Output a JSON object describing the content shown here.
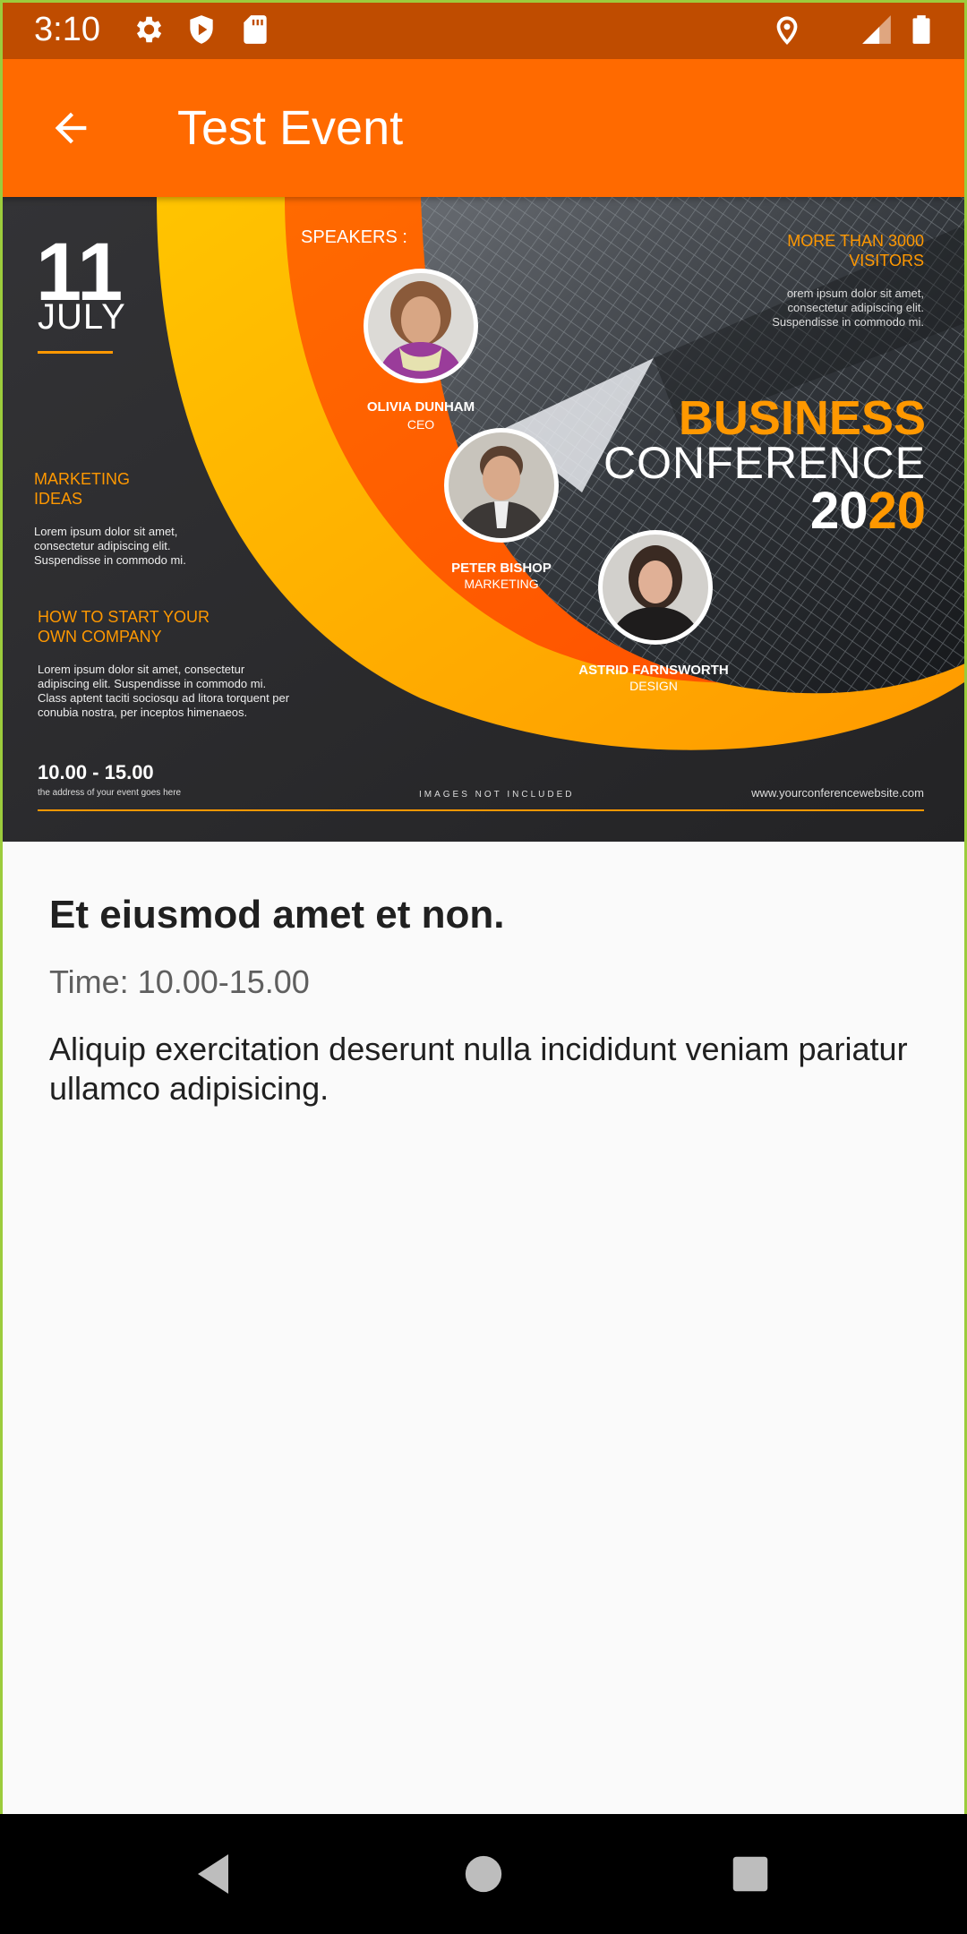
{
  "status_bar": {
    "time": "3:10",
    "icons": [
      "gear-icon",
      "shield-play-icon",
      "sd-card-icon",
      "location-pin-icon",
      "signal-icon",
      "battery-icon"
    ]
  },
  "app_bar": {
    "title": "Test Event",
    "back_icon": "arrow-back-icon",
    "color": "#ff6a00"
  },
  "poster": {
    "date_day": "11",
    "date_month": "JULY",
    "speakers_label": "SPEAKERS :",
    "speakers": [
      {
        "name": "OLIVIA DUNHAM",
        "role": "CEO"
      },
      {
        "name": "PETER BISHOP",
        "role": "MARKETING"
      },
      {
        "name": "ASTRID FARNSWORTH",
        "role": "DESIGN"
      }
    ],
    "visitors": "MORE THAN 3000 VISITORS",
    "visitors_text": "orem ipsum dolor sit amet, consectetur adipiscing elit. Suspendisse in commodo mi.",
    "section1_title": "MARKETING IDEAS",
    "section1_text": "Lorem ipsum dolor sit amet, consectetur adipiscing elit. Suspendisse in commodo mi.",
    "section2_title": "HOW TO START YOUR OWN COMPANY",
    "section2_text": "Lorem ipsum dolor sit amet, consectetur adipiscing elit. Suspendisse in commodo mi. Class aptent taciti sociosqu ad litora torquent per conubia nostra, per inceptos himenaeos.",
    "headline_1": "BUSINESS",
    "headline_2": "CONFERENCE",
    "year_a": "20",
    "year_b": "20",
    "time_range": "10.00 - 15.00",
    "address": "the address of your event goes here",
    "images_note": "IMAGES NOT INCLUDED",
    "website": "www.yourconferencewebsite.com"
  },
  "event": {
    "title": "Et eiusmod amet et non.",
    "time": "Time: 10.00-15.00",
    "description": "Aliquip exercitation deserunt nulla incididunt veniam pariatur ullamco adipisicing."
  },
  "nav_bar": {
    "back_icon": "triangle-back-icon",
    "home_icon": "circle-home-icon",
    "recents_icon": "square-recents-icon"
  }
}
